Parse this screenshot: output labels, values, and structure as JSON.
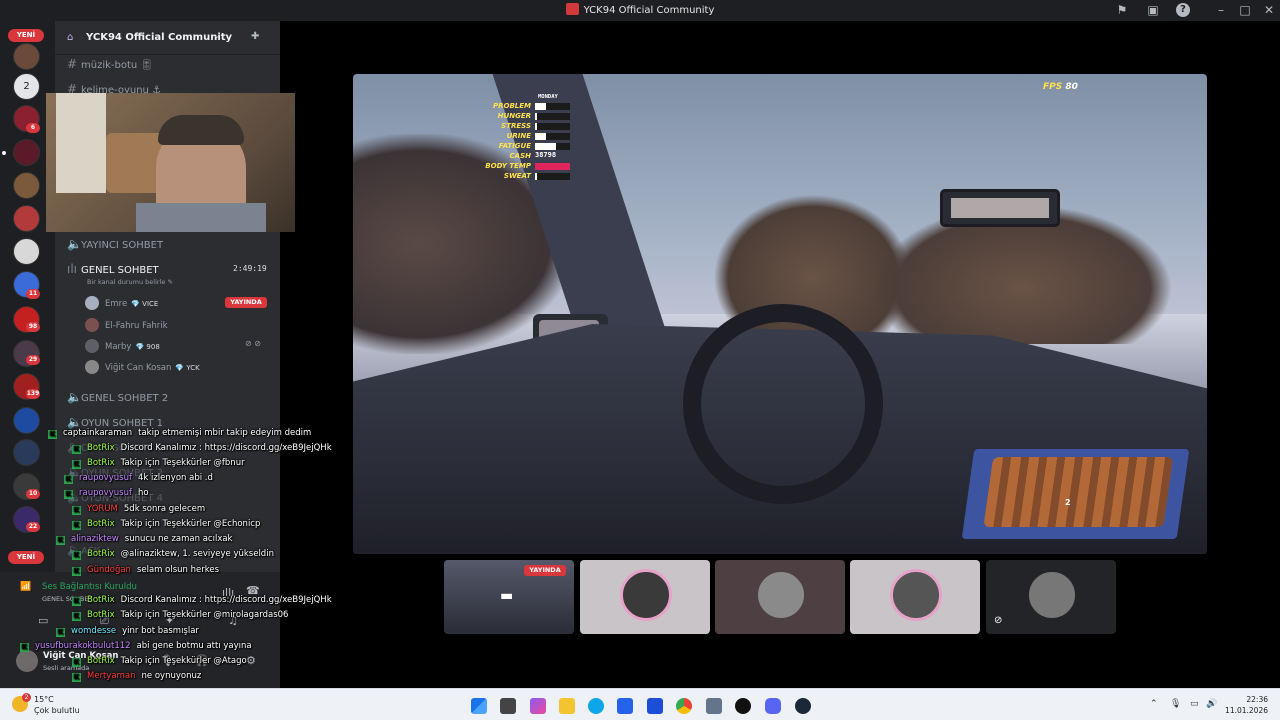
{
  "window": {
    "title": "YCK94 Official Community"
  },
  "server": {
    "name": "YCK94 Official Community"
  },
  "guilds": {
    "new_label": "YENİ",
    "badges": [
      "6",
      "11",
      "98",
      "29",
      "139",
      "10",
      "22"
    ]
  },
  "channels": {
    "text": [
      {
        "name": "müzik-botu 🎚"
      },
      {
        "name": "kelime-oyunu ⚓"
      }
    ],
    "voice": [
      {
        "name": "YAYINCI SOHBET"
      },
      {
        "name": "GENEL SOHBET",
        "time": "2:49:19",
        "status": "Bir kanal durumu belirle"
      },
      {
        "name": "GENEL SOHBET 2"
      },
      {
        "name": "OYUN SOHBET 1"
      },
      {
        "name": "OYUN SOHBET 2"
      },
      {
        "name": "OYUN SOHBET 3"
      },
      {
        "name": "OYUN SOHBET 4"
      },
      {
        "name": "AFK ⚠"
      }
    ],
    "members": [
      {
        "name": "Emre",
        "tag": "VICE"
      },
      {
        "name": "El-Fahru Fahrik",
        "tag": ""
      },
      {
        "name": "Marby",
        "tag": "908"
      },
      {
        "name": "Viğit Can Kosan",
        "tag": "YCK"
      }
    ],
    "live_label": "YAYINDA"
  },
  "voice_panel": {
    "status": "Ses Bağlantısı Kuruldu",
    "channel": "GENEL SOHBET",
    "user_name": "Viğit Can Kosan",
    "user_status": "Sesli aramada"
  },
  "game": {
    "fps_label": "FPS",
    "fps_value": "80",
    "day": "MONDAY",
    "stats": [
      {
        "label": "PROBLEM",
        "value": 0.3
      },
      {
        "label": "HUNGER",
        "value": 0.05
      },
      {
        "label": "STRESS",
        "value": 0.05
      },
      {
        "label": "URINE",
        "value": 0.3
      },
      {
        "label": "FATIGUE",
        "value": 0.6
      },
      {
        "label": "CASH",
        "value": "38798"
      },
      {
        "label": "BODY TEMP",
        "value": 1.0
      },
      {
        "label": "SWEAT",
        "value": 0.05
      }
    ],
    "crate_count": "2"
  },
  "thumbnails": {
    "live_label": "YAYINDA"
  },
  "chat": [
    {
      "user": "captainkaraman",
      "text": "takip etmemişi mbir takip edeyim dedim",
      "color": "#ffffff",
      "bot": false
    },
    {
      "user": "BotRix",
      "text": "Discord Kanalımız : https://discord.gg/xeB9JejQHk",
      "color": "#9cff3f",
      "bot": true
    },
    {
      "user": "BotRix",
      "text": "Takip için Teşekkürler @fbnur",
      "color": "#9cff3f",
      "bot": true
    },
    {
      "user": "raupovyusuf",
      "text": "4k izlenyon abi .d",
      "color": "#c586ff",
      "bot": false
    },
    {
      "user": "raupovyusuf",
      "text": "ho",
      "color": "#c586ff",
      "bot": false
    },
    {
      "user": "YORUM",
      "text": "5dk sonra gelecem",
      "color": "#ff3b3b",
      "bot": false
    },
    {
      "user": "BotRix",
      "text": "Takip için Teşekkürler @Echonicp",
      "color": "#9cff3f",
      "bot": true
    },
    {
      "user": "alinaziktew",
      "text": "sunucu ne zaman acılxak",
      "color": "#c586ff",
      "bot": false
    },
    {
      "user": "BotRix",
      "text": "@alinaziktew, 1. seviyeye yükseldin",
      "color": "#9cff3f",
      "bot": true
    },
    {
      "user": "Gündoğan",
      "text": "selam olsun herkes",
      "color": "#ff3b3b",
      "bot": false
    },
    {
      "user": "BotRix",
      "text": "Discord Kanalımız : https://discord.gg/xeB9JejQHk",
      "color": "#9cff3f",
      "bot": true
    },
    {
      "user": "BotRix",
      "text": "Takip için Teşekkürler @mirolagardas06",
      "color": "#9cff3f",
      "bot": true
    },
    {
      "user": "womdesse",
      "text": "yinr bot basmışlar",
      "color": "#6ee7ff",
      "bot": false
    },
    {
      "user": "yusufburakokbulut112",
      "text": "abi gene botmu attı yayına",
      "color": "#c586ff",
      "bot": false
    },
    {
      "user": "BotRix",
      "text": "Takip için Teşekkürler @Atago",
      "color": "#9cff3f",
      "bot": true
    },
    {
      "user": "Mertyaman",
      "text": "ne oynuyonuz",
      "color": "#ff3b3b",
      "bot": false
    }
  ],
  "taskbar": {
    "temp": "15°C",
    "weather": "Çok bulutlu",
    "notif_count": "2",
    "time": "22:36",
    "date": "11.01.2026"
  },
  "colors": {
    "accent": "#da373c",
    "bot": "#2da44e",
    "sidebar": "#2b2d31",
    "rail": "#1e1f22"
  }
}
